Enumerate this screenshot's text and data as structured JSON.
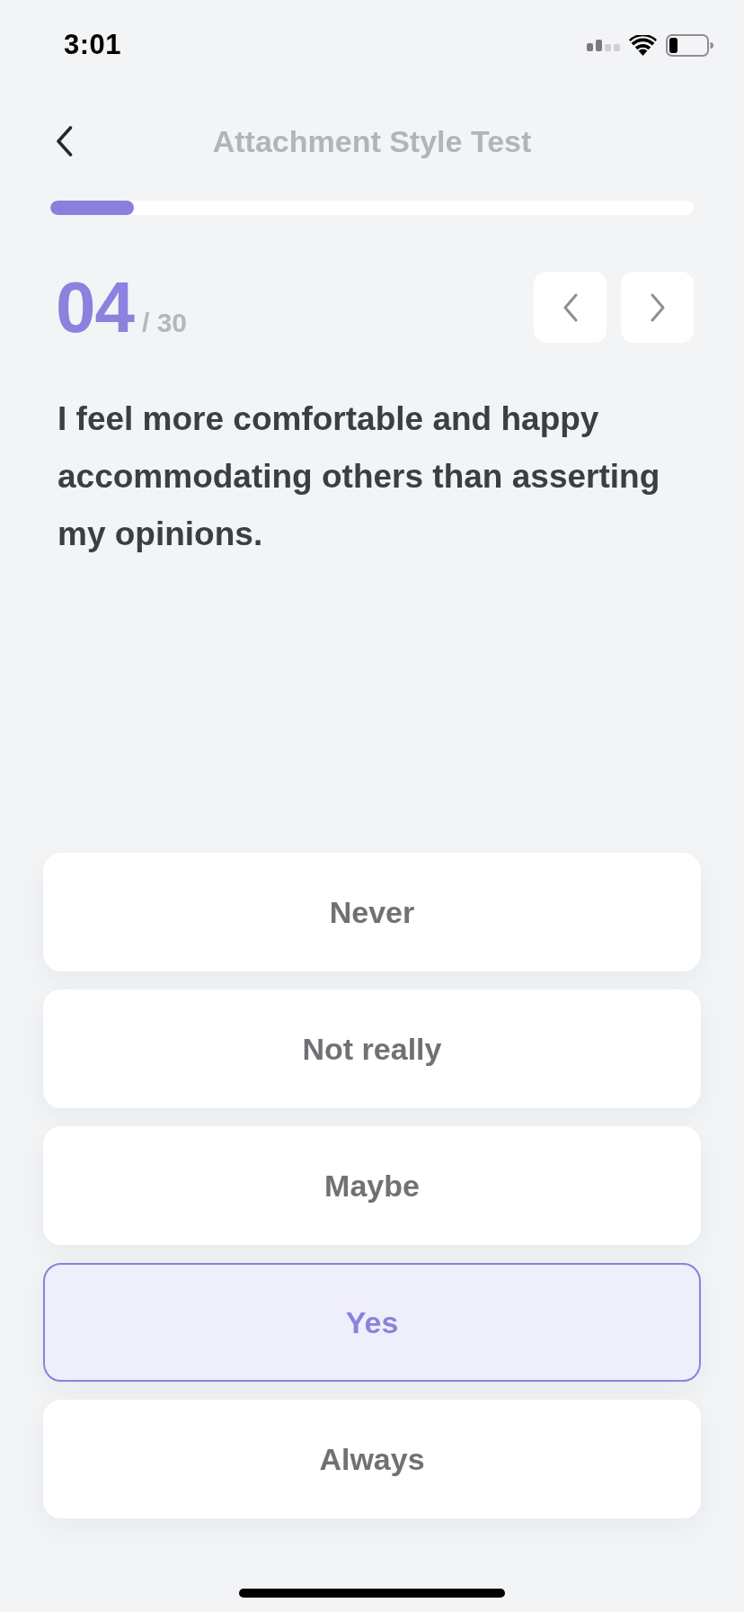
{
  "status_bar": {
    "time": "3:01"
  },
  "header": {
    "title": "Attachment Style Test"
  },
  "progress": {
    "level": 0.13
  },
  "question": {
    "number": "04",
    "total": "/ 30",
    "text": "I feel more comfortable and happy accommodating others than asserting my opinions."
  },
  "options": [
    {
      "label": "Never",
      "selected": false
    },
    {
      "label": "Not really",
      "selected": false
    },
    {
      "label": "Maybe",
      "selected": false
    },
    {
      "label": "Yes",
      "selected": true
    },
    {
      "label": "Always",
      "selected": false
    }
  ]
}
